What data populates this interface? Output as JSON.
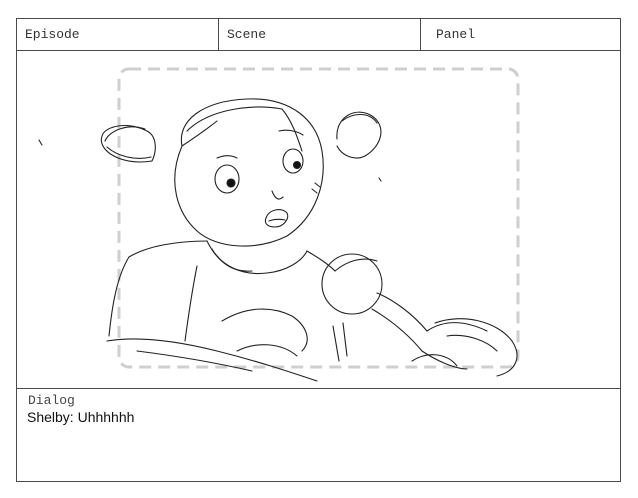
{
  "header": {
    "episode_label": "Episode",
    "scene_label": "Scene",
    "panel_label": "Panel"
  },
  "panel": {
    "drawing": "sketch-illustration",
    "safe_area": "dashed-frame"
  },
  "dialog": {
    "label": "Dialog",
    "text": "Shelby: Uhhhhhh"
  },
  "colors": {
    "border": "#4a4a4a",
    "sketch": "#222222",
    "safe_area": "#cfcfcf"
  }
}
